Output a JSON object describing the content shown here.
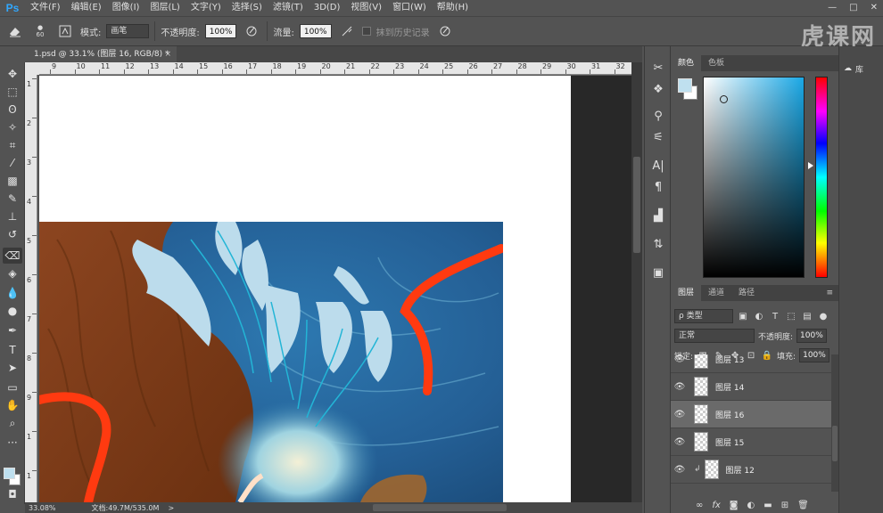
{
  "app": {
    "logo": "Ps"
  },
  "menu": {
    "items": [
      "文件(F)",
      "编辑(E)",
      "图像(I)",
      "图层(L)",
      "文字(Y)",
      "选择(S)",
      "滤镜(T)",
      "3D(D)",
      "视图(V)",
      "窗口(W)",
      "帮助(H)"
    ]
  },
  "window_controls": {
    "minimize": "—",
    "restore": "□",
    "close": "✕"
  },
  "options_bar": {
    "brush_size": "60",
    "mode_label": "模式:",
    "mode_value": "画笔",
    "opacity_label": "不透明度:",
    "opacity_value": "100%",
    "flow_label": "流量:",
    "flow_value": "100%",
    "erase_history_label": "抹到历史记录"
  },
  "watermark": "虎课网",
  "document": {
    "tab_title": "1.psd @ 33.1% (图层 16, RGB/8) *",
    "tab_close": "×"
  },
  "rulers": {
    "top": [
      "9",
      "10",
      "11",
      "12",
      "13",
      "14",
      "15",
      "16",
      "17",
      "18",
      "19",
      "20",
      "21",
      "22",
      "23",
      "24",
      "25",
      "26",
      "27",
      "28",
      "29",
      "30",
      "31",
      "32"
    ],
    "left": [
      "1",
      "2",
      "3",
      "4",
      "5",
      "6",
      "7",
      "8",
      "9",
      "1",
      "1"
    ]
  },
  "status": {
    "zoom": "33.08%",
    "doc_info": "文档:49.7M/535.0M",
    "arrow": ">"
  },
  "color_panel": {
    "tabs": [
      "颜色",
      "色板"
    ],
    "fg_color": "#bfe0ef",
    "bg_color": "#ffffff",
    "hue_base": "#1aa8e6"
  },
  "library": {
    "label": "库"
  },
  "layers_panel": {
    "tabs": [
      "图层",
      "通道",
      "路径"
    ],
    "filter_label": "ρ 类型",
    "blend_mode": "正常",
    "opacity_label": "不透明度:",
    "opacity_value": "100%",
    "lock_label": "锁定:",
    "fill_label": "填充:",
    "fill_value": "100%",
    "layers": [
      {
        "name": "图层 13",
        "selected": false,
        "clipped": false
      },
      {
        "name": "图层 14",
        "selected": false,
        "clipped": false
      },
      {
        "name": "图层 16",
        "selected": true,
        "clipped": false
      },
      {
        "name": "图层 15",
        "selected": false,
        "clipped": false
      },
      {
        "name": "图层 12",
        "selected": false,
        "clipped": true
      }
    ],
    "bottom_icons": [
      "link-icon",
      "fx-icon",
      "mask-icon",
      "adjustment-icon",
      "folder-icon",
      "new-layer-icon",
      "trash-icon"
    ]
  }
}
